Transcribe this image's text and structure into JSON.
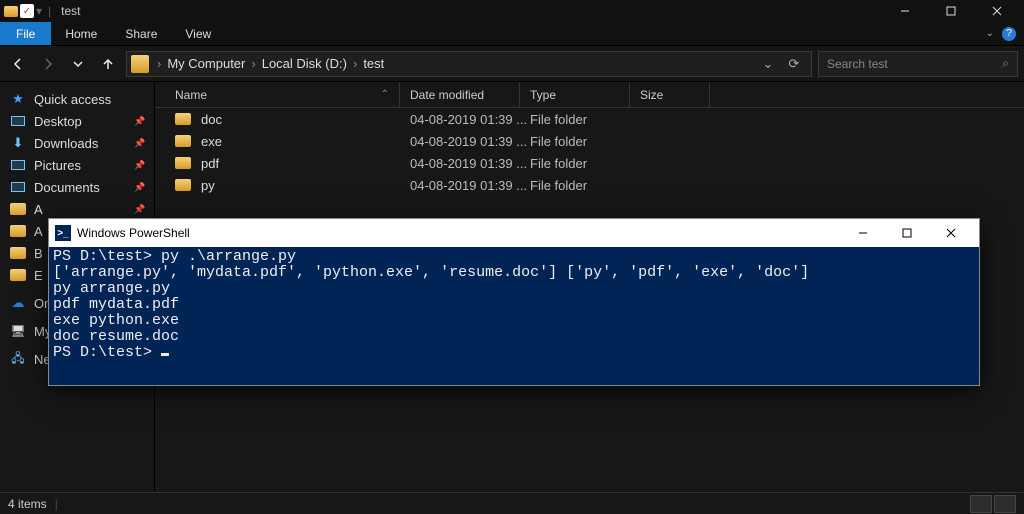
{
  "title": "test",
  "ribbon": {
    "file": "File",
    "home": "Home",
    "share": "Share",
    "view": "View"
  },
  "breadcrumb": [
    "My Computer",
    "Local Disk (D:)",
    "test"
  ],
  "search": {
    "placeholder": "Search test"
  },
  "sidebar": [
    {
      "label": "Quick access",
      "kind": "star",
      "pin": false
    },
    {
      "label": "Desktop",
      "kind": "lib",
      "pin": true
    },
    {
      "label": "Downloads",
      "kind": "down",
      "pin": true
    },
    {
      "label": "Pictures",
      "kind": "lib",
      "pin": true
    },
    {
      "label": "Documents",
      "kind": "lib",
      "pin": true
    },
    {
      "label": "A",
      "kind": "folder",
      "pin": true
    },
    {
      "label": "A",
      "kind": "folder",
      "pin": true
    },
    {
      "label": "B",
      "kind": "folder",
      "pin": true
    },
    {
      "label": "E",
      "kind": "folder",
      "pin": false
    },
    {
      "label": "On",
      "kind": "onedrive",
      "pin": false
    },
    {
      "label": "My",
      "kind": "pc",
      "pin": false
    },
    {
      "label": "Network",
      "kind": "net",
      "pin": false
    }
  ],
  "columns": {
    "name": "Name",
    "date": "Date modified",
    "type": "Type",
    "size": "Size"
  },
  "rows": [
    {
      "name": "doc",
      "date": "04-08-2019 01:39 ...",
      "type": "File folder"
    },
    {
      "name": "exe",
      "date": "04-08-2019 01:39 ...",
      "type": "File folder"
    },
    {
      "name": "pdf",
      "date": "04-08-2019 01:39 ...",
      "type": "File folder"
    },
    {
      "name": "py",
      "date": "04-08-2019 01:39 ...",
      "type": "File folder"
    }
  ],
  "status": {
    "count": "4 items"
  },
  "ps": {
    "title": "Windows PowerShell",
    "lines": [
      "PS D:\\test> py .\\arrange.py",
      "['arrange.py', 'mydata.pdf', 'python.exe', 'resume.doc'] ['py', 'pdf', 'exe', 'doc']",
      "py arrange.py",
      "pdf mydata.pdf",
      "exe python.exe",
      "doc resume.doc",
      "PS D:\\test> "
    ]
  }
}
